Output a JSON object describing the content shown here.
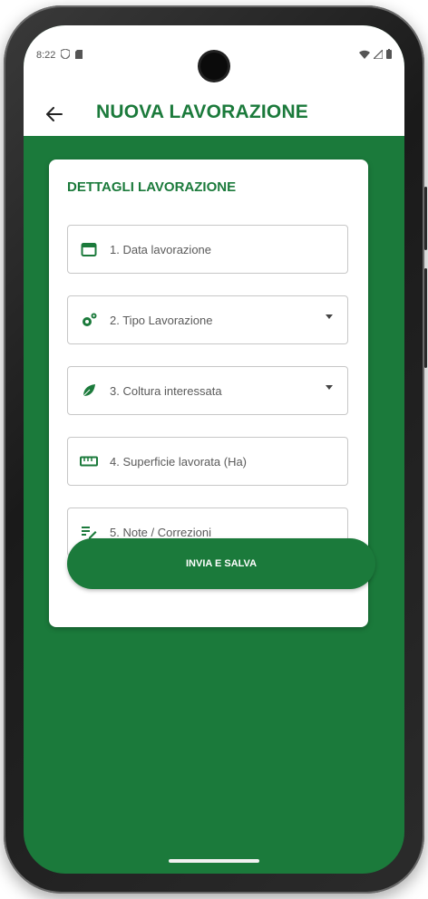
{
  "status_bar": {
    "time": "8:22",
    "left_icons": [
      "shield-icon",
      "sd-card-icon"
    ],
    "right_icons": [
      "wifi-icon",
      "signal-icon",
      "battery-icon"
    ]
  },
  "app_bar": {
    "back_icon": "arrow-left-icon",
    "title": "NUOVA LAVORAZIONE"
  },
  "card": {
    "title": "DETTAGLI LAVORAZIONE",
    "fields": [
      {
        "label": "1. Data lavorazione",
        "icon": "calendar-icon",
        "dropdown": false
      },
      {
        "label": "2. Tipo Lavorazione",
        "icon": "gears-icon",
        "dropdown": true
      },
      {
        "label": "3. Coltura interessata",
        "icon": "leaf-icon",
        "dropdown": true
      },
      {
        "label": "4. Superficie lavorata (Ha)",
        "icon": "ruler-icon",
        "dropdown": false
      },
      {
        "label": "5. Note / Correzioni",
        "icon": "edit-note-icon",
        "dropdown": false
      }
    ],
    "submit_label": "INVIA E SALVA"
  },
  "colors": {
    "primary": "#1b7a3b",
    "surface": "#ffffff",
    "field_border": "#c7c7c7"
  }
}
